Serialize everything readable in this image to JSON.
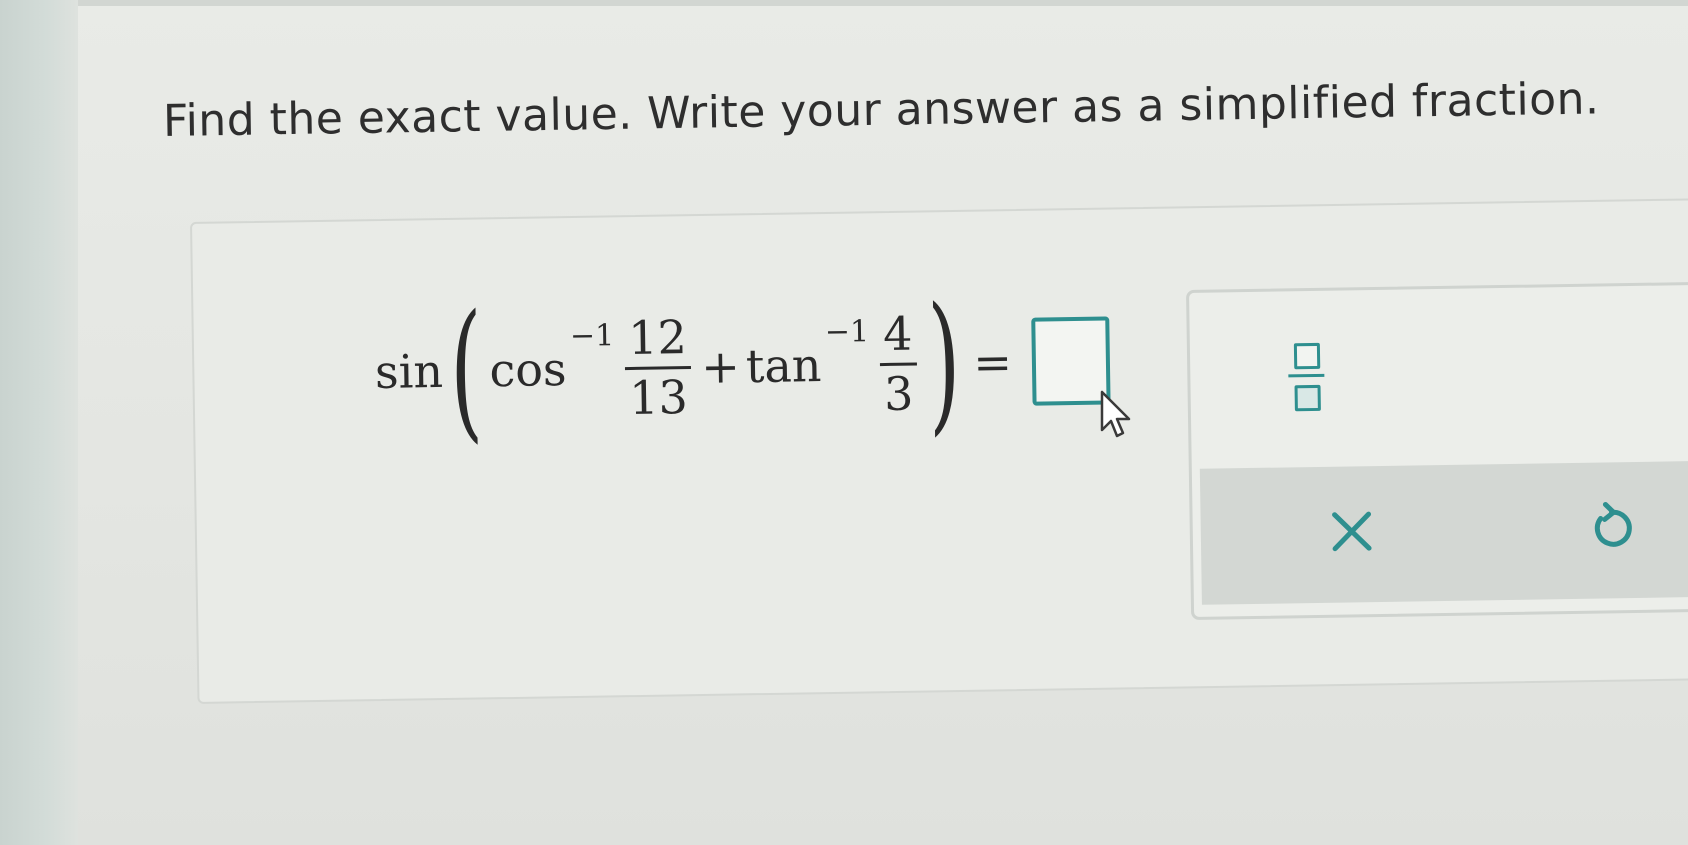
{
  "instruction": "Find the exact value. Write your answer as a simplified fraction.",
  "expression": {
    "outer_fn": "sin",
    "open_paren": "(",
    "term1_fn": "cos",
    "term1_exp": "−1",
    "term1_num": "12",
    "term1_den": "13",
    "plus": "+",
    "term2_fn": "tan",
    "term2_exp": "−1",
    "term2_num": "4",
    "term2_den": "3",
    "close_paren": ")",
    "equals": "="
  },
  "answer": {
    "value": ""
  },
  "toolbox": {
    "fraction_tool": "fraction-template-icon",
    "clear_button": "close-icon",
    "undo_button": "undo-icon"
  },
  "colors": {
    "accent": "#2e8f8f",
    "text": "#2a2a2a"
  }
}
